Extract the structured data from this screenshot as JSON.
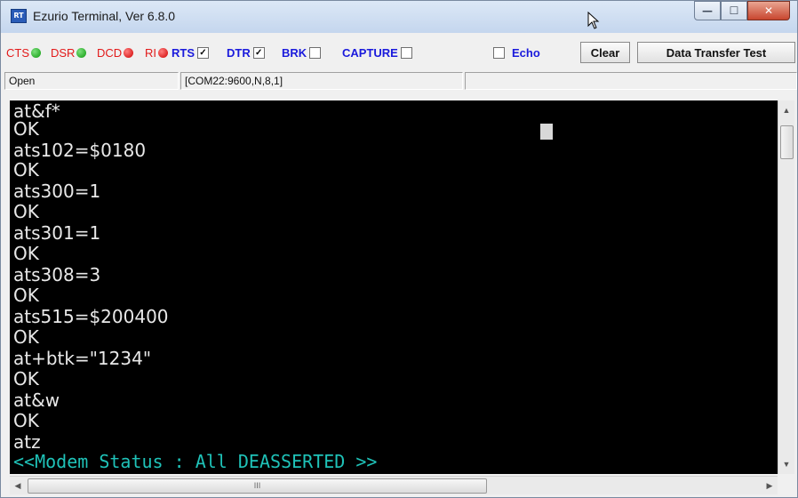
{
  "window": {
    "title": "Ezurio Terminal, Ver 6.8.0",
    "app_icon_text": "RT",
    "controls": {
      "minimize": "—",
      "maximize": "☐",
      "close": "✕"
    }
  },
  "toolbar": {
    "signals": [
      {
        "label": "CTS",
        "state": "green"
      },
      {
        "label": "DSR",
        "state": "green"
      },
      {
        "label": "DCD",
        "state": "red"
      },
      {
        "label": "RI",
        "state": "red"
      }
    ],
    "checkboxes": [
      {
        "label": "RTS",
        "checked": true
      },
      {
        "label": "DTR",
        "checked": true
      },
      {
        "label": "BRK",
        "checked": false
      },
      {
        "label": "CAPTURE",
        "checked": false
      },
      {
        "label": "Echo",
        "checked": false
      }
    ],
    "clear_label": "Clear",
    "data_transfer_label": "Data Transfer Test"
  },
  "statusbar": {
    "state": "Open",
    "port_settings": "[COM22:9600,N,8,1]",
    "extra": ""
  },
  "terminal": {
    "lines": [
      "at&f*",
      "OK",
      "ats102=$0180",
      "OK",
      "ats300=1",
      "OK",
      "ats301=1",
      "OK",
      "ats308=3",
      "OK",
      "ats515=$200400",
      "OK",
      "at+btk=\"1234\"",
      "OK",
      "at&w",
      "OK",
      "atz"
    ],
    "status_line": "<<Modem Status : All DEASSERTED >>"
  },
  "scrollbar": {
    "hthumb_grip": "III"
  }
}
